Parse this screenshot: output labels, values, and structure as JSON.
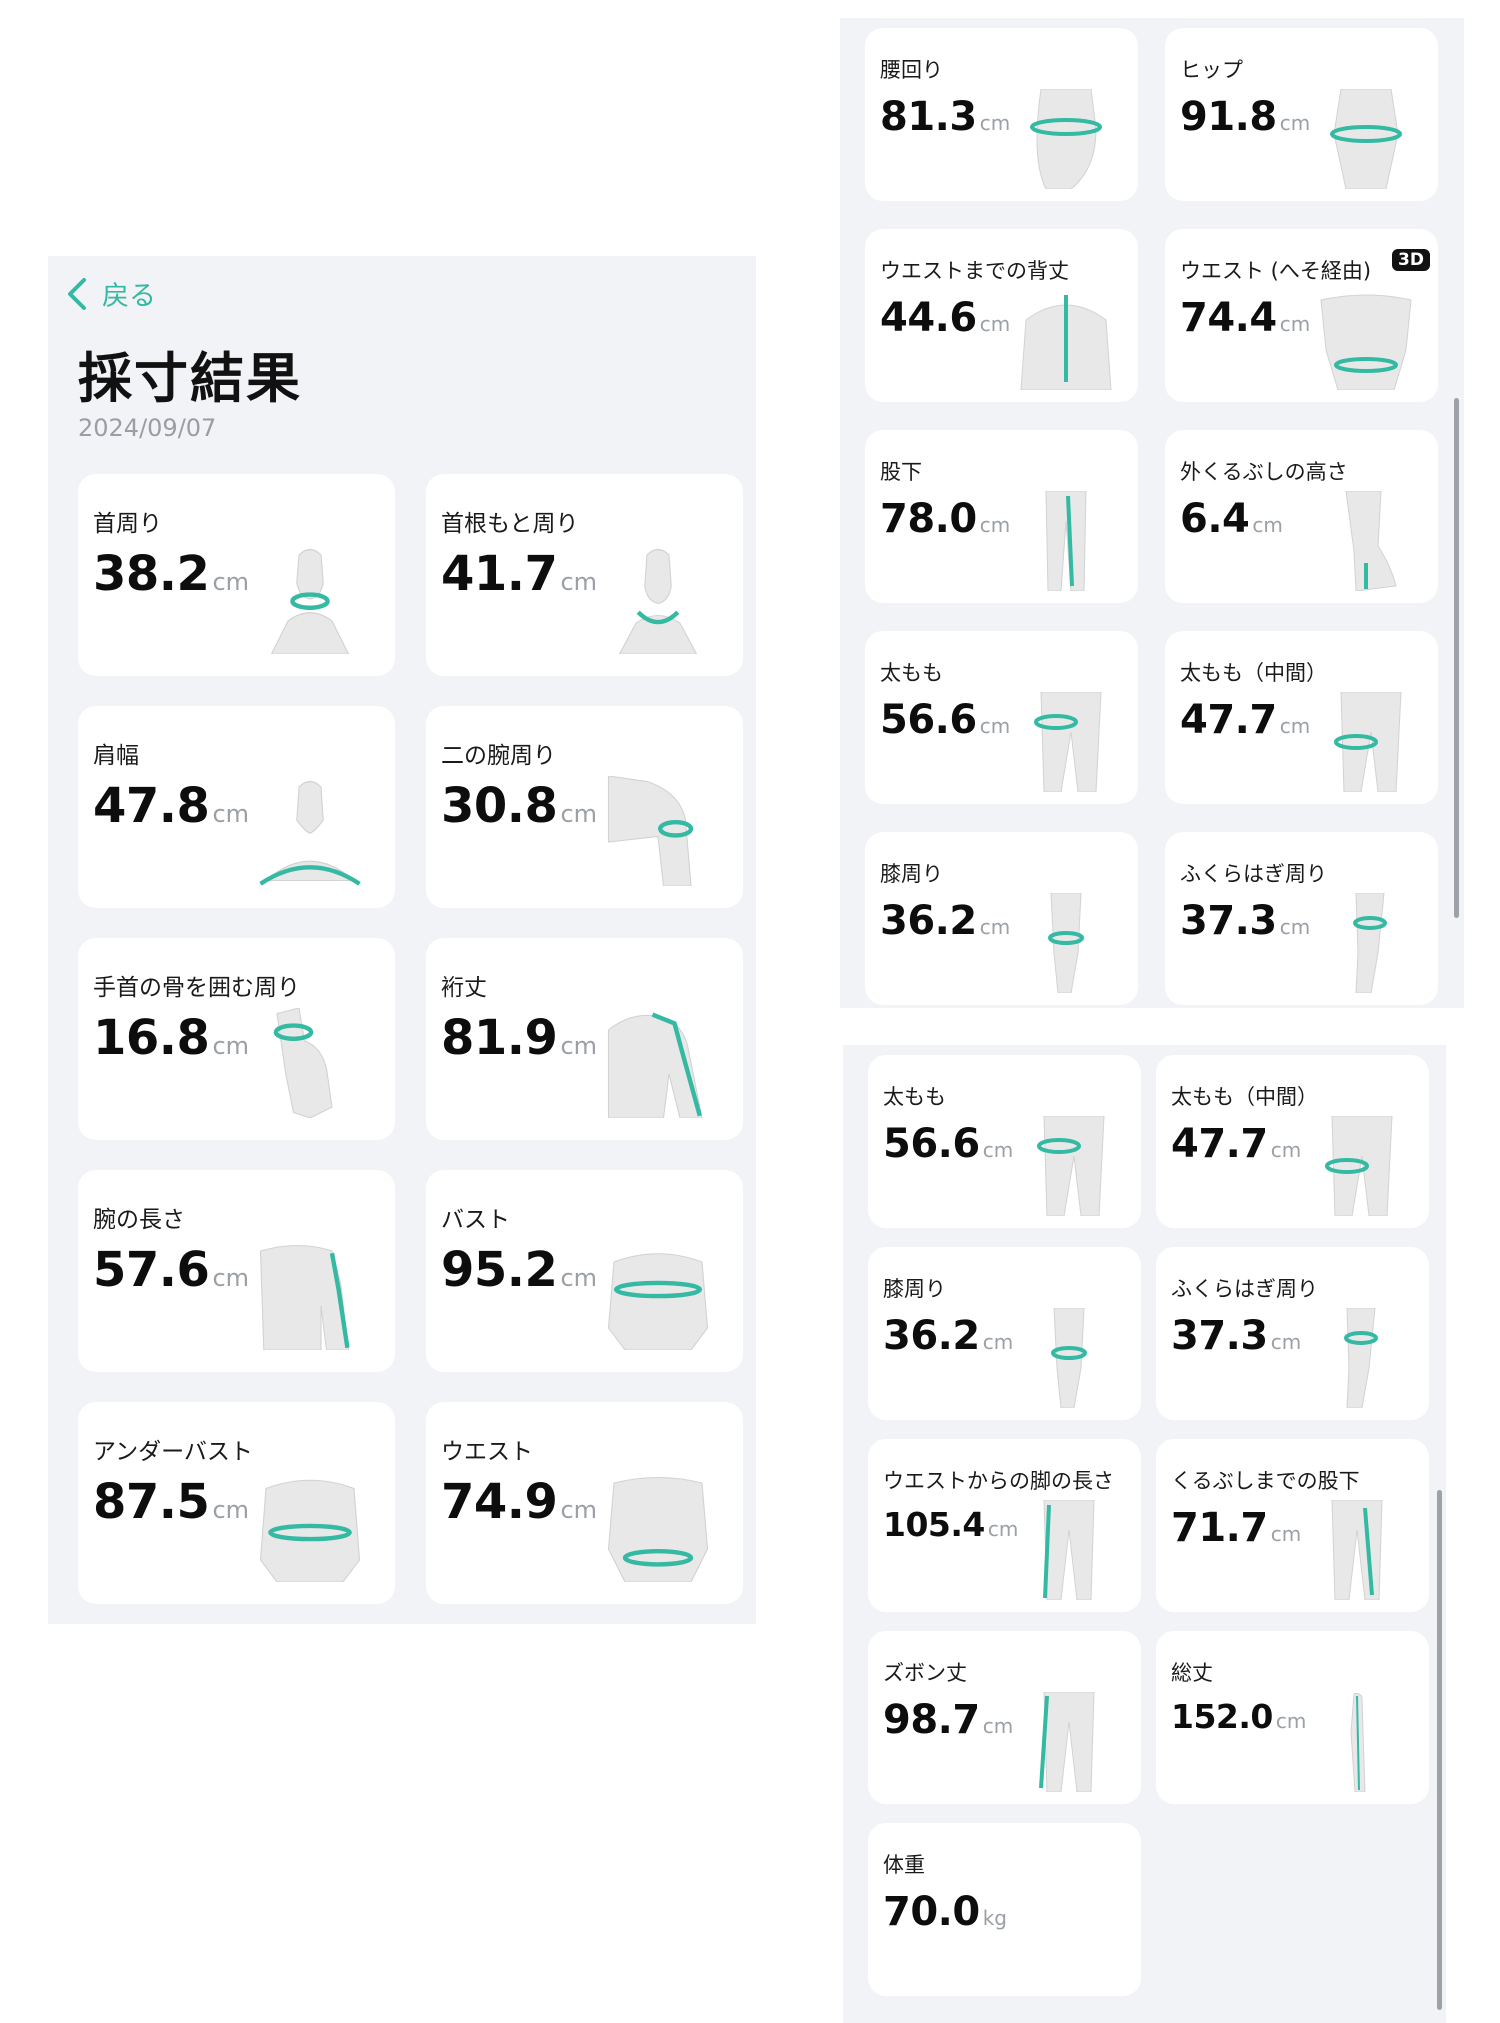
{
  "colors": {
    "accent": "#34b9a3",
    "panel_bg": "#f2f3f6",
    "card_bg": "#ffffff"
  },
  "header": {
    "back_label": "戻る",
    "title": "採寸結果",
    "date": "2024/09/07"
  },
  "screen1": {
    "cards": [
      {
        "label": "首周り",
        "value": "38.2",
        "unit": "cm",
        "icon": "neck-icon"
      },
      {
        "label": "首根もと周り",
        "value": "41.7",
        "unit": "cm",
        "icon": "neck-base-icon"
      },
      {
        "label": "肩幅",
        "value": "47.8",
        "unit": "cm",
        "icon": "shoulder-width-icon"
      },
      {
        "label": "二の腕周り",
        "value": "30.8",
        "unit": "cm",
        "icon": "upper-arm-icon"
      },
      {
        "label": "手首の骨を囲む周り",
        "value": "16.8",
        "unit": "cm",
        "icon": "wrist-icon"
      },
      {
        "label": "裄丈",
        "value": "81.9",
        "unit": "cm",
        "icon": "sleeve-length-icon"
      },
      {
        "label": "腕の長さ",
        "value": "57.6",
        "unit": "cm",
        "icon": "arm-length-icon"
      },
      {
        "label": "バスト",
        "value": "95.2",
        "unit": "cm",
        "icon": "bust-icon"
      },
      {
        "label": "アンダーバスト",
        "value": "87.5",
        "unit": "cm",
        "icon": "underbust-icon"
      },
      {
        "label": "ウエスト",
        "value": "74.9",
        "unit": "cm",
        "icon": "waist-icon"
      }
    ]
  },
  "screen2": {
    "cards": [
      {
        "label": "腰回り",
        "value": "81.3",
        "unit": "cm",
        "icon": "hip-side-icon"
      },
      {
        "label": "ヒップ",
        "value": "91.8",
        "unit": "cm",
        "icon": "hip-icon"
      },
      {
        "label": "ウエストまでの背丈",
        "value": "44.6",
        "unit": "cm",
        "icon": "back-length-icon"
      },
      {
        "label": "ウエスト (へそ経由)",
        "value": "74.4",
        "unit": "cm",
        "icon": "navel-waist-icon",
        "badge": "3D"
      },
      {
        "label": "股下",
        "value": "78.0",
        "unit": "cm",
        "icon": "inseam-icon"
      },
      {
        "label": "外くるぶしの高さ",
        "value": "6.4",
        "unit": "cm",
        "icon": "ankle-height-icon"
      },
      {
        "label": "太もも",
        "value": "56.6",
        "unit": "cm",
        "icon": "thigh-icon"
      },
      {
        "label": "太もも（中間）",
        "value": "47.7",
        "unit": "cm",
        "icon": "mid-thigh-icon"
      },
      {
        "label": "膝周り",
        "value": "36.2",
        "unit": "cm",
        "icon": "knee-icon"
      },
      {
        "label": "ふくらはぎ周り",
        "value": "37.3",
        "unit": "cm",
        "icon": "calf-icon"
      }
    ]
  },
  "screen3": {
    "cards": [
      {
        "label": "太もも",
        "value": "56.6",
        "unit": "cm",
        "icon": "thigh-icon"
      },
      {
        "label": "太もも（中間）",
        "value": "47.7",
        "unit": "cm",
        "icon": "mid-thigh-icon"
      },
      {
        "label": "膝周り",
        "value": "36.2",
        "unit": "cm",
        "icon": "knee-icon"
      },
      {
        "label": "ふくらはぎ周り",
        "value": "37.3",
        "unit": "cm",
        "icon": "calf-icon"
      },
      {
        "label": "ウエストからの脚の長さ",
        "value": "105.4",
        "unit": "cm",
        "icon": "leg-length-icon"
      },
      {
        "label": "くるぶしまでの股下",
        "value": "71.7",
        "unit": "cm",
        "icon": "inseam-ankle-icon"
      },
      {
        "label": "ズボン丈",
        "value": "98.7",
        "unit": "cm",
        "icon": "trouser-length-icon"
      },
      {
        "label": "総丈",
        "value": "152.0",
        "unit": "cm",
        "icon": "total-height-icon"
      },
      {
        "label": "体重",
        "value": "70.0",
        "unit": "kg",
        "icon": "weight-icon"
      }
    ]
  }
}
